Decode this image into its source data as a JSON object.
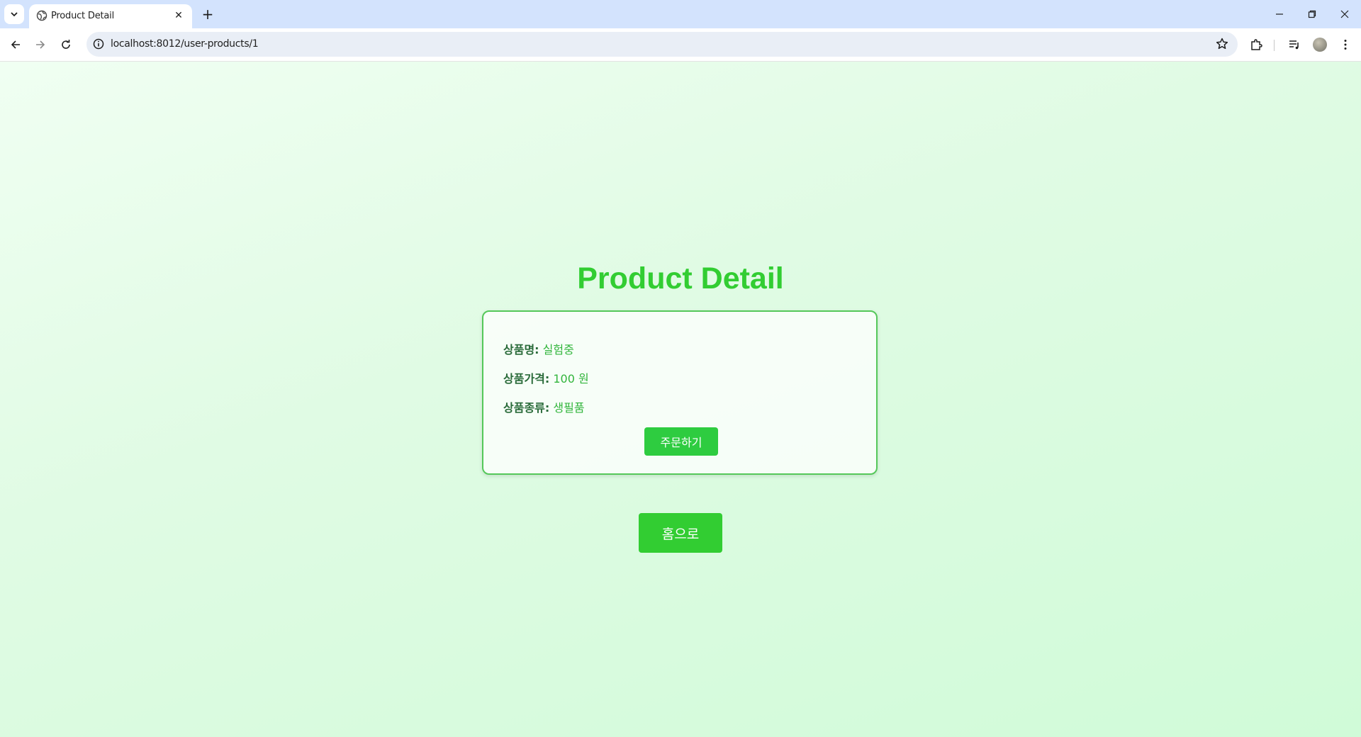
{
  "browser": {
    "tab_title": "Product Detail",
    "url": "localhost:8012/user-products/1",
    "icons": [
      "tab-search-icon",
      "globe-icon",
      "close-icon",
      "plus-icon",
      "minimize-icon",
      "restore-icon",
      "window-close-icon",
      "back-icon",
      "forward-icon",
      "reload-icon",
      "info-icon",
      "star-icon",
      "extensions-icon",
      "media-icon",
      "avatar",
      "menu-icon"
    ]
  },
  "page": {
    "title": "Product Detail",
    "product": {
      "name_label": "상품명:",
      "name_value": "실험중",
      "price_label": "상품가격:",
      "price_value": "100 원",
      "type_label": "상품종류:",
      "type_value": "생필품"
    },
    "order_button": "주문하기",
    "home_button": "홈으로"
  },
  "colors": {
    "accent": "#32cd32",
    "button": "#2ecc40",
    "label": "#2a6b3a",
    "value": "#32b53c",
    "tabbar": "#d3e3fd"
  }
}
